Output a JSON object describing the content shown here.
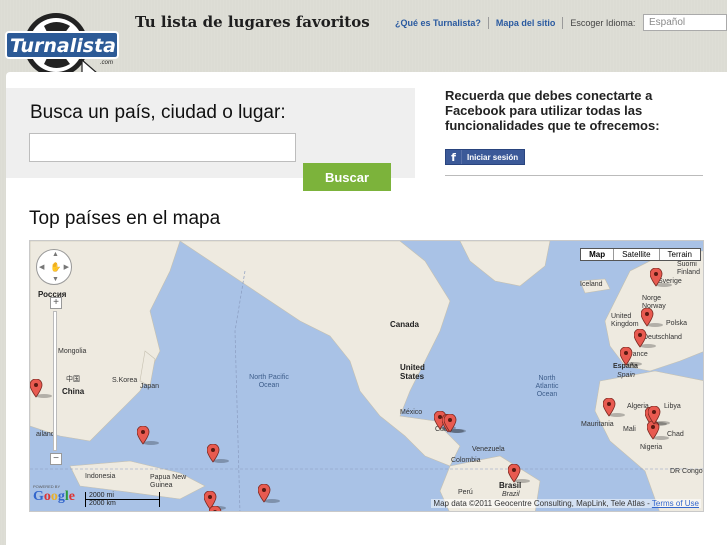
{
  "header": {
    "logo_text": "Turnalista",
    "logo_suffix": ".com",
    "tagline": "Tu lista de lugares favoritos",
    "nav": {
      "what_is": "¿Qué es Turnalista?",
      "site_map": "Mapa del sitio",
      "choose_language": "Escoger Idioma:",
      "language_value": "Español"
    }
  },
  "search": {
    "title": "Busca un país, ciudad o lugar:",
    "input_value": "",
    "button_label": "Buscar"
  },
  "facebook": {
    "message": "Recuerda que debes conectarte a Facebook para utilizar todas las funcionalidades que te ofrecemos:",
    "login_label": "Iniciar sesión",
    "icon": "facebook-icon"
  },
  "top_countries": {
    "title": "Top países en el mapa"
  },
  "map": {
    "type_buttons": [
      "Map",
      "Satellite",
      "Terrain"
    ],
    "selected_type": "Map",
    "labels": {
      "canada": "Canada",
      "united_states": "United States",
      "mexico": "México",
      "china": "China",
      "china_native": "中国",
      "russia": "Россия",
      "russia_sub": "Ru",
      "mongolia": "Mongolia",
      "s_korea": "S.Korea",
      "japan": "Japan",
      "north_pacific": "North Pacific Ocean",
      "north_atlantic": "North Atlantic Ocean",
      "iceland": "Iceland",
      "suomi": "Suomi Finland",
      "sverige": "Sverige",
      "norge": "Norge Norway",
      "united_kingdom": "United Kingdom",
      "polska": "Polska",
      "deutschland": "Deutschland",
      "france": "France",
      "espana": "España",
      "spain": "Spain",
      "algeria": "Algeria",
      "libya": "Libya",
      "mauritania": "Mauritania",
      "mali": "Mali",
      "chad": "Chad",
      "nigeria": "Nigeria",
      "dr_congo": "DR Congo",
      "venezuela": "Venezuela",
      "colombia": "Colombia",
      "peru": "Perú",
      "brasil": "Brasil",
      "brazil": "Brazil",
      "cuba": "Cuba",
      "indonesia": "Indonesia",
      "papua": "Papua New Guinea",
      "thailand": "ailand"
    },
    "powered_by": "POWERED BY",
    "google": "Google",
    "scale_top": "2000 mi",
    "scale_bottom": "2000 km",
    "attribution": "Map data ©2011 Geocentre Consulting, MapLink, Tele Atlas -",
    "attribution_link": "Terms of Use",
    "marker_count": 20,
    "colors": {
      "water": "#a9c2e6",
      "land": "#eeeae0",
      "marker": "#e85a50",
      "search_button": "#7cb33b",
      "facebook": "#3b5998"
    }
  }
}
